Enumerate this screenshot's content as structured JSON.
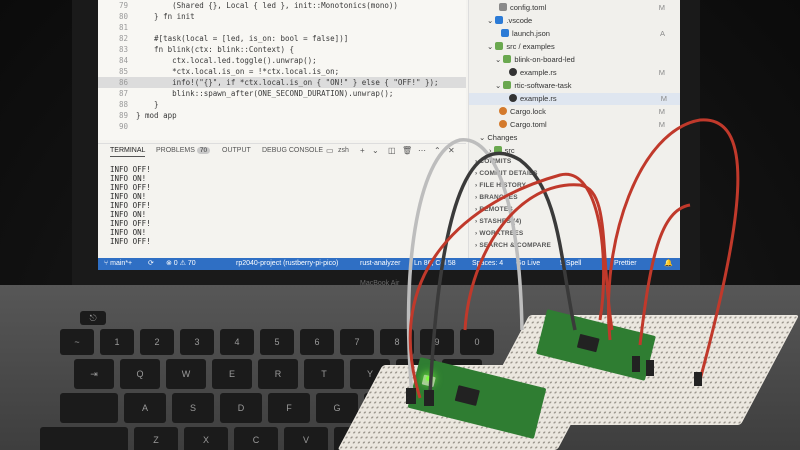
{
  "editor": {
    "lines": [
      {
        "num": "79",
        "code": "        (Shared {}, Local { led }, init::Monotonics(mono))"
      },
      {
        "num": "80",
        "code": "    } fn init"
      },
      {
        "num": "81",
        "code": ""
      },
      {
        "num": "82",
        "code": "    #[task(local = [led, is_on: bool = false])]"
      },
      {
        "num": "83",
        "code": "    fn blink(ctx: blink::Context) {"
      },
      {
        "num": "84",
        "code": "        ctx.local.led.toggle().unwrap();"
      },
      {
        "num": "85",
        "code": "        *ctx.local.is_on = !*ctx.local.is_on;"
      },
      {
        "num": "86",
        "code": "        info!(\"{}\", if *ctx.local.is_on { \"ON!\" } else { \"OFF!\" });"
      },
      {
        "num": "87",
        "code": "        blink::spawn_after(ONE_SECOND_DURATION).unwrap();"
      },
      {
        "num": "88",
        "code": "    }"
      },
      {
        "num": "89",
        "code": "} mod app"
      },
      {
        "num": "90",
        "code": ""
      }
    ]
  },
  "terminal": {
    "tabs": {
      "terminal": "TERMINAL",
      "problems": "PROBLEMS",
      "problems_count": "70",
      "output": "OUTPUT",
      "debug_console": "DEBUG CONSOLE"
    },
    "shell": "zsh",
    "output_lines": [
      "INFO  OFF!",
      "INFO  ON!",
      "INFO  OFF!",
      "INFO  ON!",
      "INFO  OFF!",
      "INFO  ON!",
      "INFO  OFF!",
      "INFO  ON!",
      "INFO  OFF!"
    ]
  },
  "explorer": {
    "items": [
      {
        "label": "config.toml",
        "status": "M"
      },
      {
        "label": ".vscode",
        "status": ""
      },
      {
        "label": "launch.json",
        "status": "A"
      },
      {
        "label": "src / examples",
        "status": ""
      },
      {
        "label": "blink-on-board-led",
        "status": ""
      },
      {
        "label": "example.rs",
        "status": "M"
      },
      {
        "label": "rtic-software-task",
        "status": ""
      },
      {
        "label": "example.rs",
        "status": "M"
      },
      {
        "label": "Cargo.lock",
        "status": "M"
      },
      {
        "label": "Cargo.toml",
        "status": "M"
      },
      {
        "label": "Changes",
        "status": ""
      },
      {
        "label": "src",
        "status": ""
      }
    ],
    "sections": [
      "COMMITS",
      "COMMIT DETAILS",
      "FILE HISTORY",
      "BRANCHES",
      "REMOTES",
      "STASHES (4)",
      "WORKTREES",
      "SEARCH & COMPARE"
    ]
  },
  "statusbar": {
    "branch": "main*+",
    "problems": "⊗ 0 ⚠ 70",
    "project": "rp2040-project (rustberry-pi-pico)",
    "analyzer": "rust-analyzer",
    "position": "Ln 86, Col 58",
    "spaces": "Spaces: 4",
    "golive": "Go Live",
    "spell": "5 Spell",
    "prettier": "Prettier"
  },
  "laptop": {
    "brand": "MacBook Air"
  },
  "keyboard": {
    "row1": [
      "~",
      "1",
      "2",
      "3",
      "4",
      "5",
      "6",
      "7",
      "8",
      "9",
      "0"
    ],
    "row2": [
      "Q",
      "W",
      "E",
      "R",
      "T",
      "Y",
      "U",
      "I"
    ],
    "row3": [
      "A",
      "S",
      "D",
      "F",
      "G",
      "H",
      "J"
    ],
    "row4": [
      "Z",
      "X",
      "C",
      "V",
      "B",
      "N"
    ]
  },
  "colors": {
    "statusbar": "#2f6fc4",
    "led": "#7CFF3C",
    "pico": "#2f7d32",
    "wire_red": "#c0392b",
    "wire_grey": "#bdbdbd"
  }
}
